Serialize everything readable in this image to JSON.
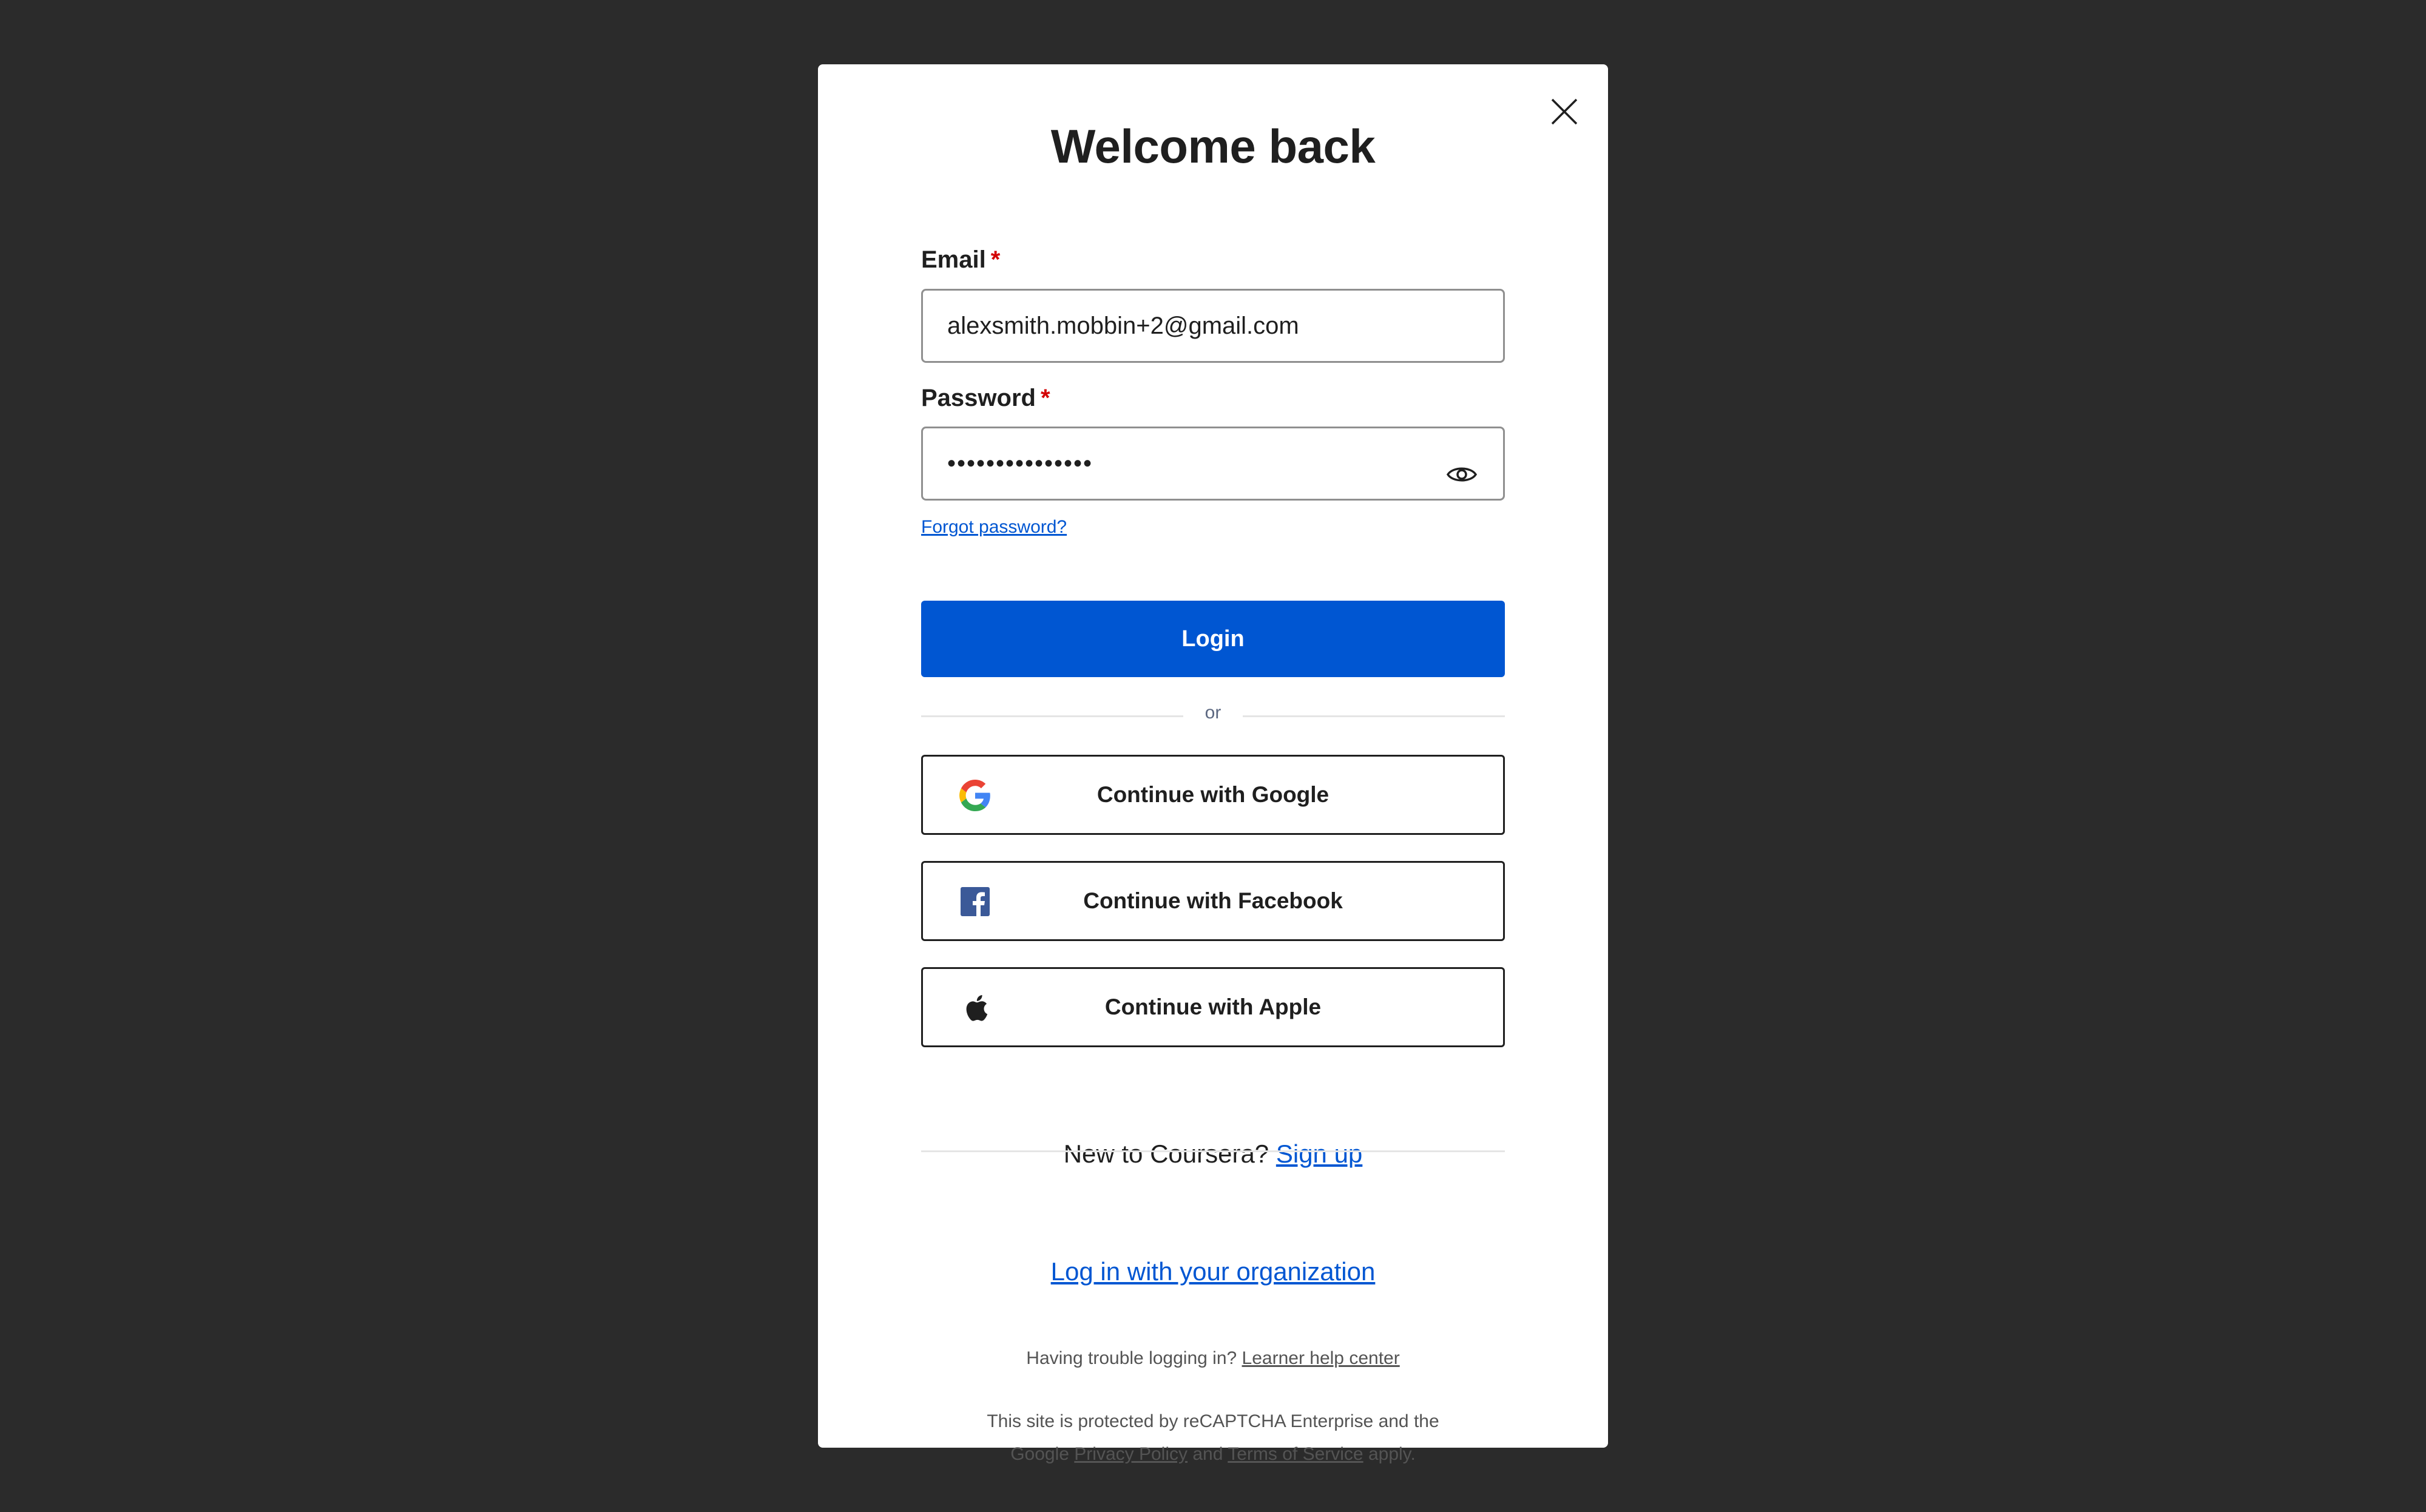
{
  "modal": {
    "title": "Welcome back",
    "close_icon": "close-icon"
  },
  "email": {
    "label": "Email",
    "required_mark": "*",
    "value": "alexsmith.mobbin+2@gmail.com"
  },
  "password": {
    "label": "Password",
    "required_mark": "*",
    "masked_value": "•••••••••••••••",
    "toggle_icon": "eye-icon"
  },
  "forgot_password": "Forgot password?",
  "login_button": "Login",
  "divider_text": "or",
  "sso": {
    "google": "Continue with Google",
    "facebook": "Continue with Facebook",
    "apple": "Continue with Apple"
  },
  "signup": {
    "prompt": "New to Coursera?",
    "link": "Sign up"
  },
  "org_login": "Log in with your organization",
  "help": {
    "prompt": "Having trouble logging in?",
    "link": "Learner help center"
  },
  "recaptcha": {
    "line1": "This site is protected by reCAPTCHA Enterprise and the",
    "line2_prefix": "Google",
    "privacy": "Privacy Policy",
    "and": "and",
    "terms": "Terms of Service",
    "suffix": "apply."
  },
  "colors": {
    "background": "#2b2b2b",
    "primary": "#0056d2",
    "required": "#d30001",
    "facebook": "#3b5998"
  }
}
